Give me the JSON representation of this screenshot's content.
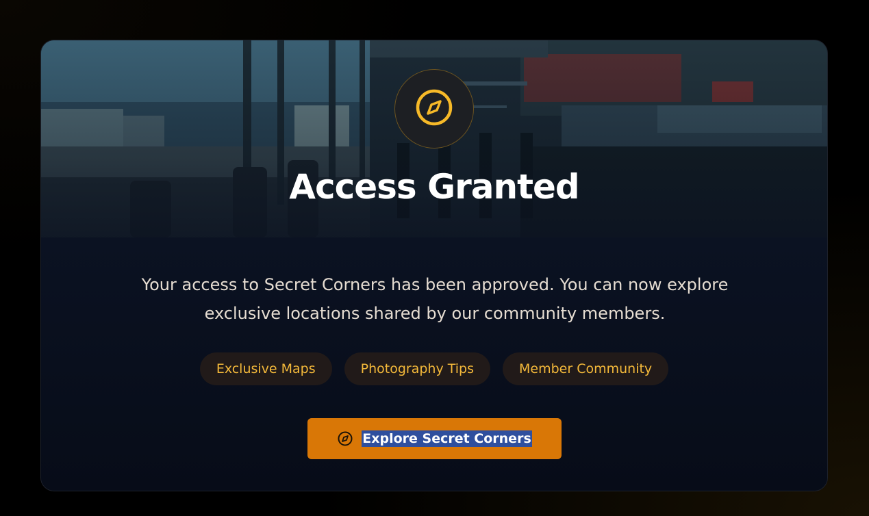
{
  "card": {
    "title": "Access Granted",
    "badge_icon": "compass-icon",
    "description": "Your access to Secret Corners has been approved. You can now explore exclusive locations shared by our community members.",
    "tags": [
      {
        "label": "Exclusive Maps"
      },
      {
        "label": "Photography Tips"
      },
      {
        "label": "Member Community"
      }
    ],
    "cta": {
      "label": "Explore Secret Corners",
      "icon": "compass-icon"
    }
  },
  "colors": {
    "accent": "#f4b93a",
    "button": "#d97706",
    "card_bg": "#060b16",
    "tag_bg": "#211a19",
    "selection": "#2f4f9e"
  }
}
